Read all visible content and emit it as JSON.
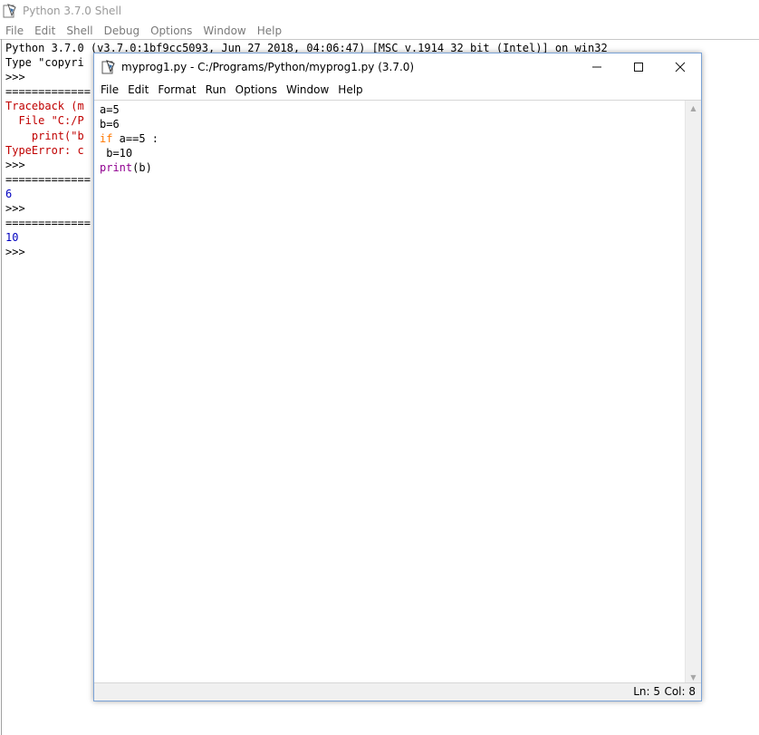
{
  "shell": {
    "title": "Python 3.7.0 Shell",
    "menu": [
      "File",
      "Edit",
      "Shell",
      "Debug",
      "Options",
      "Window",
      "Help"
    ],
    "lines": [
      {
        "text": "Python 3.7.0 (v3.7.0:1bf9cc5093, Jun 27 2018, 04:06:47) [MSC v.1914 32 bit (Intel)] on win32",
        "kind": "normal"
      },
      {
        "text": "Type \"copyri",
        "kind": "normal"
      },
      {
        "text": ">>>",
        "kind": "normal"
      },
      {
        "text": "=============",
        "kind": "sep"
      },
      {
        "text": "Traceback (m",
        "kind": "err"
      },
      {
        "text": "  File \"C:/P",
        "kind": "err"
      },
      {
        "text": "    print(\"b",
        "kind": "err"
      },
      {
        "text": "TypeError: c",
        "kind": "err"
      },
      {
        "text": ">>>",
        "kind": "normal"
      },
      {
        "text": "=============",
        "kind": "sep"
      },
      {
        "text": "6",
        "kind": "out"
      },
      {
        "text": ">>>",
        "kind": "normal"
      },
      {
        "text": "=============",
        "kind": "sep"
      },
      {
        "text": "10",
        "kind": "out"
      },
      {
        "text": ">>>",
        "kind": "normal"
      }
    ]
  },
  "editor": {
    "title": "myprog1.py - C:/Programs/Python/myprog1.py (3.7.0)",
    "menu": [
      "File",
      "Edit",
      "Format",
      "Run",
      "Options",
      "Window",
      "Help"
    ],
    "code": [
      [
        {
          "t": "a=5",
          "c": ""
        }
      ],
      [
        {
          "t": "b=6",
          "c": ""
        }
      ],
      [
        {
          "t": "if",
          "c": "kw"
        },
        {
          "t": " a==5 :",
          "c": ""
        }
      ],
      [
        {
          "t": " b=10",
          "c": ""
        }
      ],
      [
        {
          "t": "print",
          "c": "bi"
        },
        {
          "t": "(b)",
          "c": ""
        }
      ]
    ],
    "status": {
      "line": "Ln: 5",
      "col": "Col: 8"
    }
  },
  "icons": {
    "minimize": "minimize-icon",
    "maximize": "maximize-icon",
    "close": "close-icon",
    "app": "python-idle-icon"
  },
  "colors": {
    "keyword": "#ff7700",
    "builtin": "#900090",
    "error": "#c00000",
    "output": "#0000c0"
  }
}
